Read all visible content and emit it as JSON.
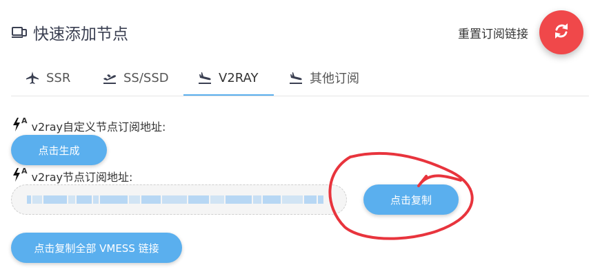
{
  "header": {
    "title": "快速添加节点",
    "reset_label": "重置订阅链接",
    "icons": {
      "title": "laptop-icon",
      "refresh": "refresh-icon"
    },
    "accent": "#f0484a"
  },
  "tabs": [
    {
      "label": "SSR",
      "icon": "plane-icon",
      "active": false
    },
    {
      "label": "SS/SSD",
      "icon": "plane-departure-icon",
      "active": false
    },
    {
      "label": "V2RAY",
      "icon": "plane-arrival-icon",
      "active": true
    },
    {
      "label": "其他订阅",
      "icon": "plane-arrival-icon",
      "active": false
    }
  ],
  "custom_section": {
    "label": "v2ray自定义节点订阅地址:",
    "generate_button": "点击生成"
  },
  "sub_section": {
    "label": "v2ray节点订阅地址:",
    "url_value": "(blurred)",
    "copy_button": "点击复制"
  },
  "copy_all_button": "点击复制全部 VMESS 链接",
  "colors": {
    "primary": "#5aafee",
    "annotation": "#e8343d"
  }
}
